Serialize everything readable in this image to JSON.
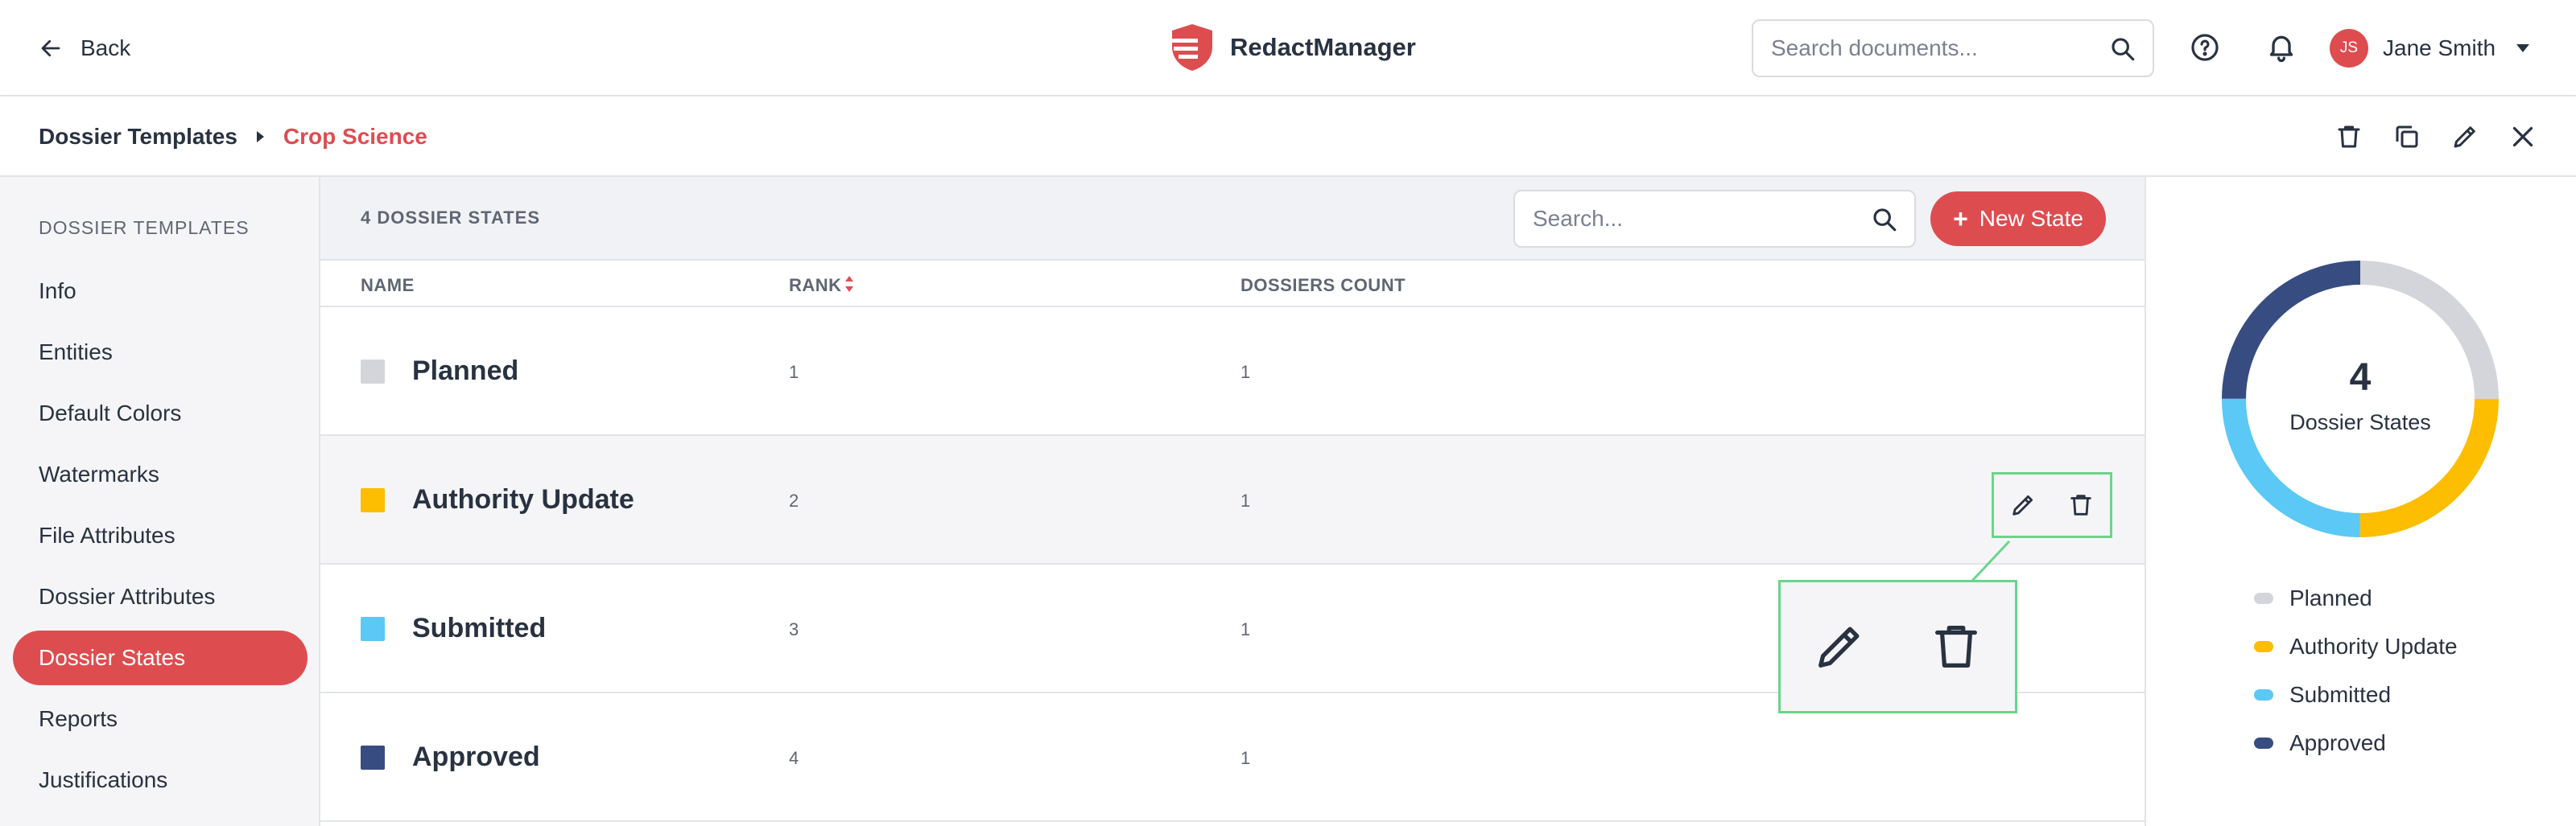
{
  "header": {
    "back_label": "Back",
    "app_name": "RedactManager",
    "search_placeholder": "Search documents...",
    "user": {
      "initials": "JS",
      "name": "Jane Smith"
    }
  },
  "breadcrumb": {
    "parent": "Dossier Templates",
    "current": "Crop Science"
  },
  "sidebar": {
    "title": "DOSSIER TEMPLATES",
    "items": [
      {
        "label": "Info",
        "active": false
      },
      {
        "label": "Entities",
        "active": false
      },
      {
        "label": "Default Colors",
        "active": false
      },
      {
        "label": "Watermarks",
        "active": false
      },
      {
        "label": "File Attributes",
        "active": false
      },
      {
        "label": "Dossier Attributes",
        "active": false
      },
      {
        "label": "Dossier States",
        "active": true
      },
      {
        "label": "Reports",
        "active": false
      },
      {
        "label": "Justifications",
        "active": false
      }
    ]
  },
  "table": {
    "count_label": "4 DOSSIER STATES",
    "search_placeholder": "Search...",
    "new_button_label": "New State",
    "columns": {
      "name": "NAME",
      "rank": "RANK",
      "count": "DOSSIERS COUNT"
    },
    "rows": [
      {
        "name": "Planned",
        "rank": "1",
        "count": "1",
        "color": "#d3d5da"
      },
      {
        "name": "Authority Update",
        "rank": "2",
        "count": "1",
        "color": "#fdbd00"
      },
      {
        "name": "Submitted",
        "rank": "3",
        "count": "1",
        "color": "#5bc8f5"
      },
      {
        "name": "Approved",
        "rank": "4",
        "count": "1",
        "color": "#374c81"
      }
    ]
  },
  "summary": {
    "total": "4",
    "label": "Dossier States",
    "legend": [
      {
        "label": "Planned",
        "color": "#d3d5da"
      },
      {
        "label": "Authority Update",
        "color": "#fdbd00"
      },
      {
        "label": "Submitted",
        "color": "#5bc8f5"
      },
      {
        "label": "Approved",
        "color": "#374c81"
      }
    ]
  },
  "colors": {
    "accent": "#dd4d50",
    "highlight": "#6ad58b",
    "text": "#283241"
  }
}
